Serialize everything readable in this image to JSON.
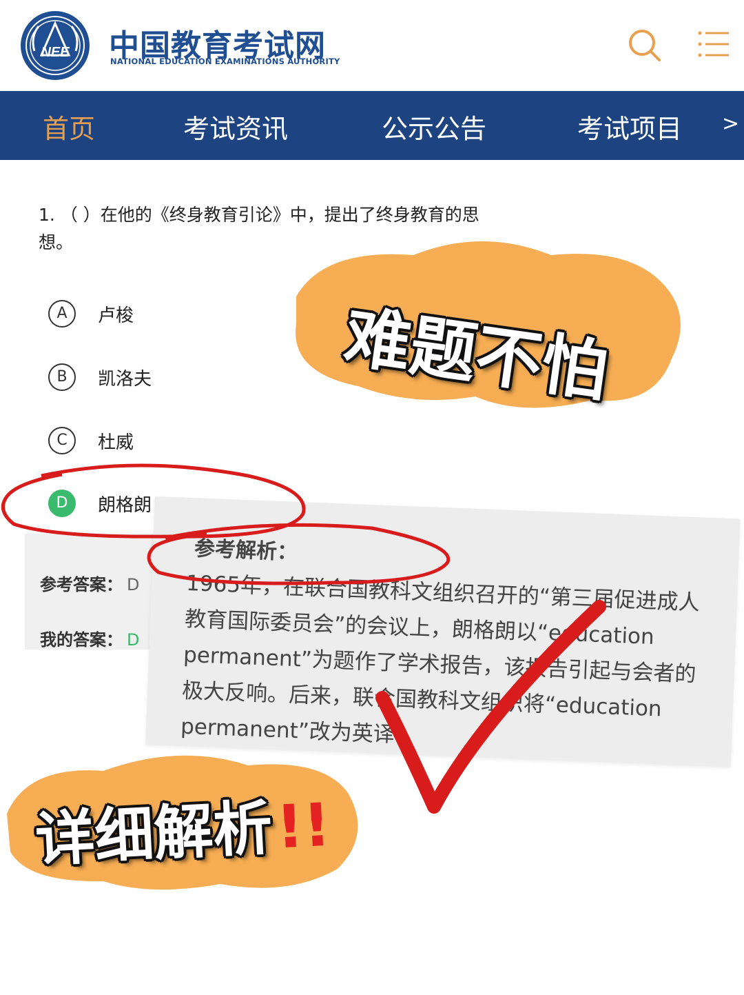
{
  "status": {
    "dots": "•••"
  },
  "header": {
    "logo_text": "NEE",
    "brand_cn": "中国教育考试网",
    "brand_en": "NATIONAL EDUCATION EXAMINATIONS AUTHORITY"
  },
  "nav": {
    "items": [
      {
        "label": "首页",
        "active": true
      },
      {
        "label": "考试资讯"
      },
      {
        "label": "公示公告"
      },
      {
        "label": "考试项目"
      }
    ],
    "more": ">"
  },
  "question": {
    "text": "1. （  ）在他的《终身教育引论》中，提出了终身教育的思想。",
    "options": [
      {
        "letter": "A",
        "text": "卢梭"
      },
      {
        "letter": "B",
        "text": "凯洛夫"
      },
      {
        "letter": "C",
        "text": "杜威"
      },
      {
        "letter": "D",
        "text": "朗格朗",
        "correct": true
      }
    ]
  },
  "answer": {
    "ref_label": "参考答案：",
    "ref_value": "D",
    "mine_label": "我的答案：",
    "mine_value": "D"
  },
  "analysis": {
    "title": "参考解析：",
    "body": "1965年，在联合国教科文组织召开的“第三届促进成人教育国际委员会”的会议上，朗格朗以“education permanent”为题作了学术报告，该报告引起与会者的极大反响。后来，联合国教科文组织将“education permanent”改为英译"
  },
  "stickers": {
    "top": "难题不怕",
    "bottom": "详细解析",
    "bottom_bang": "!!"
  },
  "colors": {
    "brand_blue": "#1f4e92",
    "nav_bg": "#1d4480",
    "nav_active": "#e8a04e",
    "correct_green": "#3aba6c",
    "sticker_orange": "#f5a94a",
    "mark_red": "#d81b1b"
  }
}
